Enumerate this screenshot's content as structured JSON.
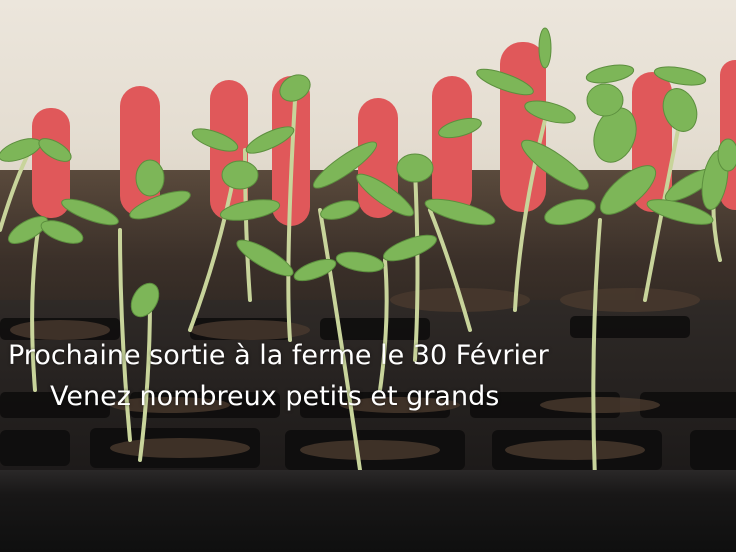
{
  "caption": {
    "line1": "Prochaine sortie à la ferme le 30 Février",
    "line2": "Venez nombreux petits et grands"
  },
  "colors": {
    "wall": "#e8e2d8",
    "soil": "#3b3029",
    "tray": "#1f1c1b",
    "label_tag": "#e05a5a",
    "leaf": "#7fb85a",
    "stem": "#c9d6a0",
    "caption_text": "#ffffff"
  }
}
